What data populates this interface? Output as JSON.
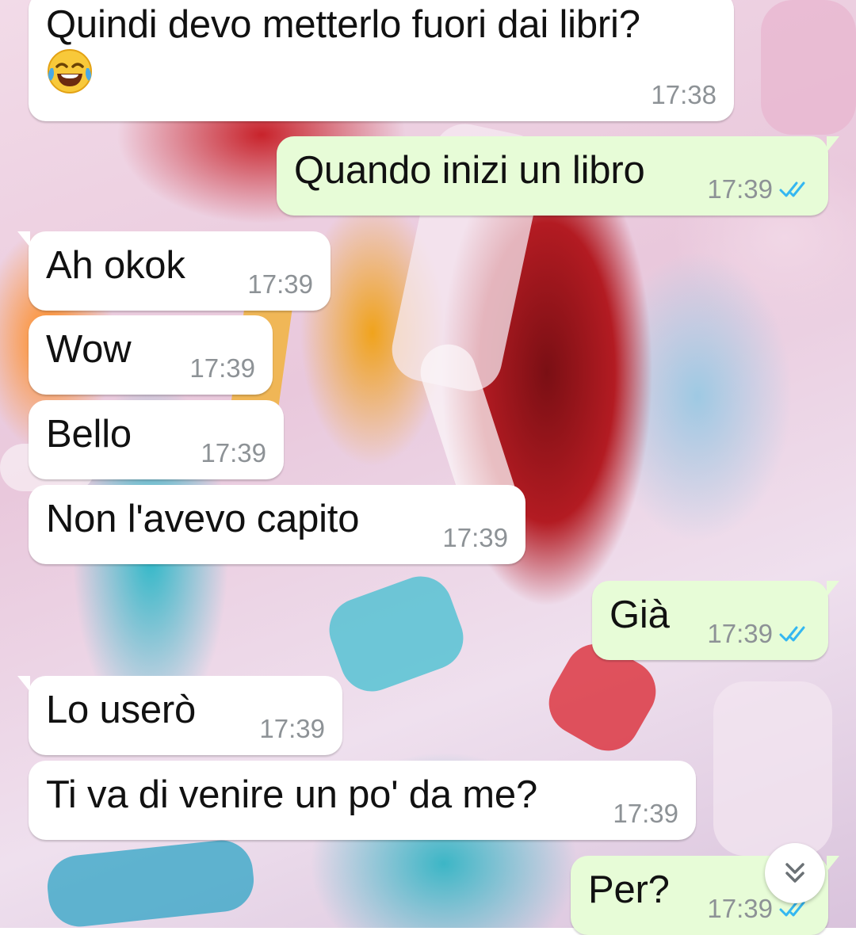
{
  "chat": {
    "messages": [
      {
        "direction": "incoming",
        "text": "Quindi devo metterlo fuori dai libri?",
        "emoji": "face-with-tears-of-joy",
        "time": "17:38"
      },
      {
        "direction": "outgoing",
        "text": "Quando inizi un libro",
        "time": "17:39",
        "status": "read"
      },
      {
        "direction": "incoming",
        "text": "Ah okok",
        "time": "17:39"
      },
      {
        "direction": "incoming",
        "text": "Wow",
        "time": "17:39"
      },
      {
        "direction": "incoming",
        "text": "Bello",
        "time": "17:39"
      },
      {
        "direction": "incoming",
        "text": "Non l'avevo capito",
        "time": "17:39"
      },
      {
        "direction": "outgoing",
        "text": "Già",
        "time": "17:39",
        "status": "read"
      },
      {
        "direction": "incoming",
        "text": "Lo userò",
        "time": "17:39"
      },
      {
        "direction": "incoming",
        "text": "Ti va di venire un po' da me?",
        "time": "17:39"
      },
      {
        "direction": "outgoing",
        "text": "Per?",
        "time": "17:39",
        "status": "read"
      }
    ],
    "scroll_button_icon": "double-chevron-down-icon"
  },
  "colors": {
    "incoming_bubble": "#ffffff",
    "outgoing_bubble": "#e7fcd7",
    "timestamp": "#8d9296",
    "read_ticks": "#34b7f1"
  }
}
